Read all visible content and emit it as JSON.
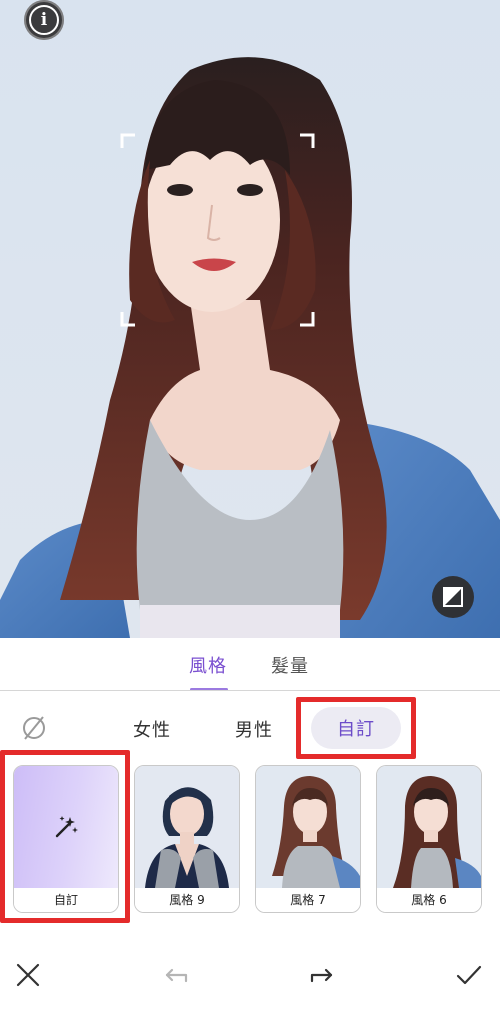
{
  "tabs": [
    {
      "label": "風格",
      "active": true
    },
    {
      "label": "髮量",
      "active": false
    }
  ],
  "categories": {
    "none_icon": "no-style-icon",
    "items": [
      {
        "label": "女性",
        "selected": false
      },
      {
        "label": "男性",
        "selected": false
      },
      {
        "label": "自訂",
        "selected": true
      }
    ]
  },
  "styles": [
    {
      "label": "自訂",
      "icon": "magic-wand-icon",
      "selected": true
    },
    {
      "label": "風格 9",
      "selected": false
    },
    {
      "label": "風格 7",
      "selected": false
    },
    {
      "label": "風格 6",
      "selected": false
    }
  ],
  "toolbar": {
    "cancel_icon": "close-icon",
    "undo_icon": "undo-icon",
    "redo_icon": "redo-icon",
    "apply_icon": "checkmark-icon"
  },
  "overlay": {
    "info_icon": "info-icon",
    "compare_icon": "compare-icon"
  },
  "colors": {
    "accent": "#7a4fd0",
    "highlight_box": "#e42b2b",
    "pill_bg": "#ecebf3"
  }
}
